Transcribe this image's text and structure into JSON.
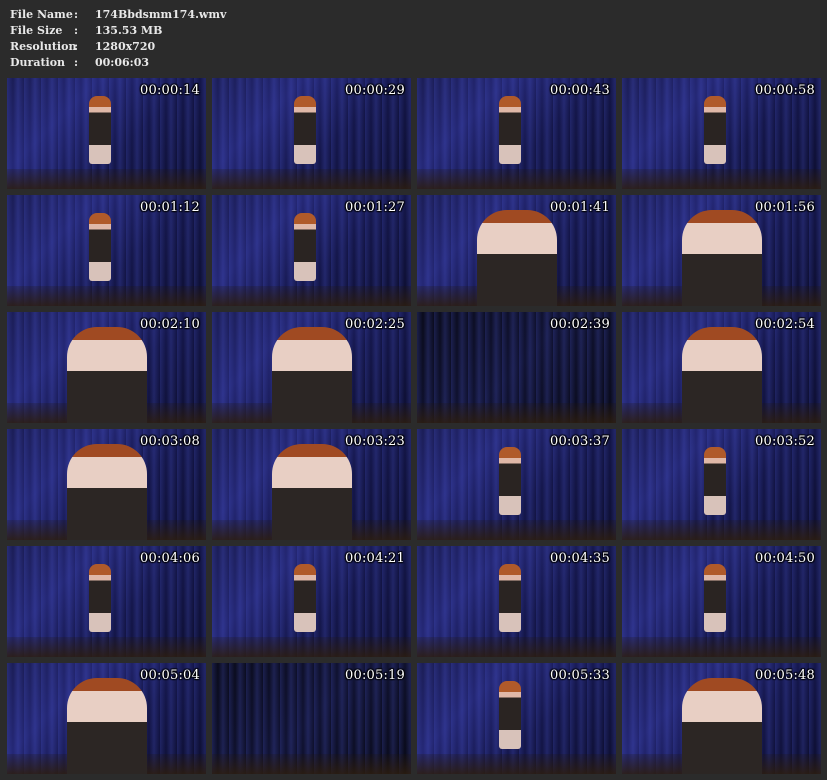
{
  "info": {
    "file_name_label": "File Name",
    "file_name_value": "174Bbdsmm174.wmv",
    "file_size_label": "File Size",
    "file_size_value": "135.53 MB",
    "resolution_label": "Resolution",
    "resolution_value": "1280x720",
    "duration_label": "Duration",
    "duration_value": "00:06:03",
    "separator": ":"
  },
  "thumbnails": [
    {
      "time": "00:00:14",
      "scene": "full-figure"
    },
    {
      "time": "00:00:29",
      "scene": "full-figure"
    },
    {
      "time": "00:00:43",
      "scene": "full-figure"
    },
    {
      "time": "00:00:58",
      "scene": "full-figure"
    },
    {
      "time": "00:01:12",
      "scene": "full-figure"
    },
    {
      "time": "00:01:27",
      "scene": "full-figure"
    },
    {
      "time": "00:01:41",
      "scene": "close-up"
    },
    {
      "time": "00:01:56",
      "scene": "close-up"
    },
    {
      "time": "00:02:10",
      "scene": "close-up"
    },
    {
      "time": "00:02:25",
      "scene": "close-up"
    },
    {
      "time": "00:02:39",
      "scene": "dark"
    },
    {
      "time": "00:02:54",
      "scene": "close-up"
    },
    {
      "time": "00:03:08",
      "scene": "close-up"
    },
    {
      "time": "00:03:23",
      "scene": "close-up"
    },
    {
      "time": "00:03:37",
      "scene": "full-figure"
    },
    {
      "time": "00:03:52",
      "scene": "full-figure"
    },
    {
      "time": "00:04:06",
      "scene": "full-figure"
    },
    {
      "time": "00:04:21",
      "scene": "full-figure"
    },
    {
      "time": "00:04:35",
      "scene": "full-figure"
    },
    {
      "time": "00:04:50",
      "scene": "full-figure"
    },
    {
      "time": "00:05:04",
      "scene": "close-up"
    },
    {
      "time": "00:05:19",
      "scene": "dark"
    },
    {
      "time": "00:05:33",
      "scene": "full-figure"
    },
    {
      "time": "00:05:48",
      "scene": "close-up"
    }
  ]
}
